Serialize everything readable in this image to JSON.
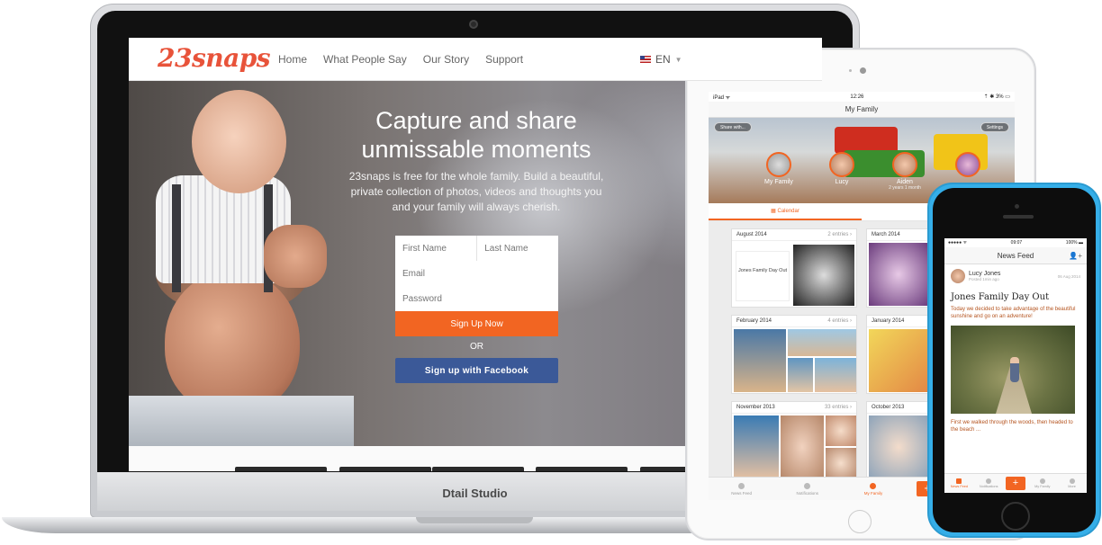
{
  "site": {
    "logo": "23snaps",
    "nav": [
      "Home",
      "What People Say",
      "Our Story",
      "Support"
    ],
    "language": "EN",
    "hero_title": "Capture and share unmissable moments",
    "hero_subtitle": "23snaps is free for the whole family. Build a beautiful, private collection of photos, videos and thoughts you and your family will always cherish.",
    "form": {
      "first_name_placeholder": "First Name",
      "last_name_placeholder": "Last Name",
      "email_placeholder": "Email",
      "password_placeholder": "Password",
      "signup_label": "Sign Up Now",
      "or_label": "OR",
      "facebook_label": "Sign up with Facebook"
    }
  },
  "laptop": {
    "brand": "Dtail Studio"
  },
  "ipad": {
    "status_left": "iPad ᯤ",
    "status_time": "12:26",
    "status_right": "⇡ ✱ 3% ▭",
    "title": "My Family",
    "share_label": "Share with...",
    "settings_label": "Settings",
    "members": [
      {
        "name": "My Family",
        "sub": ""
      },
      {
        "name": "Lucy",
        "sub": ""
      },
      {
        "name": "Aiden",
        "sub": "2 years 1 month"
      }
    ],
    "calendar_tab": "Calendar",
    "other_tab": "T",
    "cards": [
      {
        "month": "August 2014",
        "count": "2 entries",
        "caption": "Jones Family Day Out"
      },
      {
        "month": "March 2014",
        "count": "",
        "caption": ""
      },
      {
        "month": "February 2014",
        "count": "4 entries",
        "caption": ""
      },
      {
        "month": "January 2014",
        "count": "",
        "caption": ""
      },
      {
        "month": "November 2013",
        "count": "33 entries",
        "caption": ""
      },
      {
        "month": "October 2013",
        "count": "",
        "caption": ""
      }
    ],
    "tabs": [
      "News Feed",
      "Notifications",
      "My Family",
      "+",
      "My connections"
    ]
  },
  "iphone": {
    "status_time": "09:07",
    "status_battery": "100% ▬",
    "title": "News Feed",
    "post": {
      "author": "Lucy Jones",
      "posted": "Posted 1min ago",
      "date": "06 Aug 2014",
      "title": "Jones Family Day Out",
      "body": "Today we decided to take advantage of the beautiful sunshine and go on an adventure!",
      "footer": "First we walked through the woods, then headed to the beach ..."
    },
    "tabs": [
      "News Feed",
      "Notifications",
      "+",
      "My Family",
      "More"
    ]
  },
  "colors": {
    "brand": "#e8533a",
    "accent": "#f26522",
    "facebook": "#3b5998",
    "iphone_case": "#35aee8"
  },
  "icons": [
    "flag-us-icon",
    "chevron-down-icon",
    "calendar-icon",
    "list-icon",
    "bell-icon",
    "person-icon",
    "plus-icon",
    "more-icon",
    "add-person-icon",
    "chevron-right-icon"
  ]
}
